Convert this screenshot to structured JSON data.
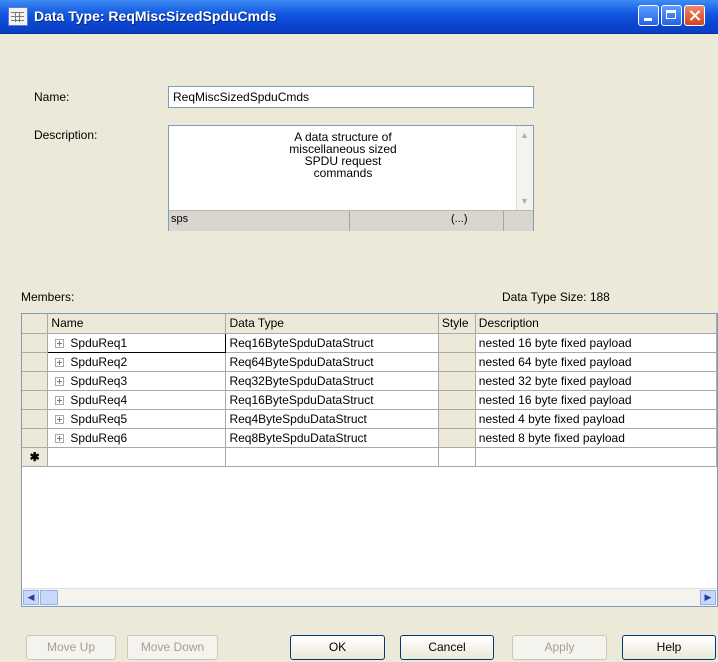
{
  "window": {
    "title": "Data Type:  ReqMiscSizedSpduCmds"
  },
  "form": {
    "name_label": "Name:",
    "name_value": "ReqMiscSizedSpduCmds",
    "description_label": "Description:",
    "description_text": "A data structure of\nmiscellaneous sized\nSPDU request\ncommands",
    "description_status_left": "sps",
    "description_status_right": "(...)"
  },
  "members": {
    "label": "Members:",
    "size_text": "Data Type Size: 188",
    "columns": [
      "Name",
      "Data Type",
      "Style",
      "Description"
    ],
    "rows": [
      {
        "name": "SpduReq1",
        "data_type": "Req16ByteSpduDataStruct",
        "style": "",
        "description": "nested 16 byte fixed payload"
      },
      {
        "name": "SpduReq2",
        "data_type": "Req64ByteSpduDataStruct",
        "style": "",
        "description": "nested 64 byte fixed payload"
      },
      {
        "name": "SpduReq3",
        "data_type": "Req32ByteSpduDataStruct",
        "style": "",
        "description": "nested 32 byte fixed payload"
      },
      {
        "name": "SpduReq4",
        "data_type": "Req16ByteSpduDataStruct",
        "style": "",
        "description": "nested 16 byte fixed payload"
      },
      {
        "name": "SpduReq5",
        "data_type": "Req4ByteSpduDataStruct",
        "style": "",
        "description": "nested 4 byte fixed payload"
      },
      {
        "name": "SpduReq6",
        "data_type": "Req8ByteSpduDataStruct",
        "style": "",
        "description": "nested 8 byte fixed payload"
      }
    ],
    "new_row_marker": "✱"
  },
  "buttons": {
    "move_up": "Move Up",
    "move_down": "Move Down",
    "ok": "OK",
    "cancel": "Cancel",
    "apply": "Apply",
    "help": "Help"
  }
}
